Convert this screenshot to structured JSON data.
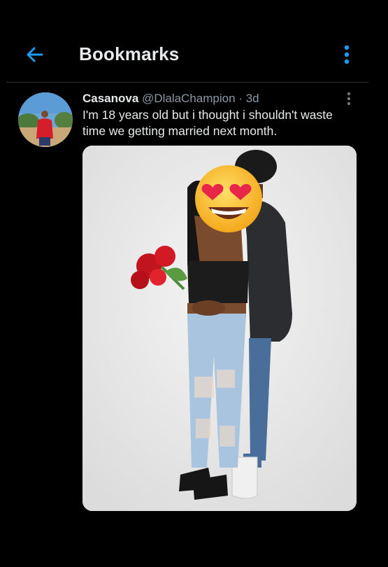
{
  "header": {
    "title": "Bookmarks",
    "back_icon": "arrow-left-icon",
    "more_icon": "vertical-dots-icon",
    "accent_color": "#1d9bf0"
  },
  "tweet": {
    "display_name": "Casanova",
    "handle": "@DlalaChampion",
    "separator": "·",
    "time": "3d",
    "text": "I'm 18 years old but i thought i shouldn't waste time we getting married next month.",
    "menu_icon": "vertical-dots-icon",
    "emoji": "😍"
  }
}
